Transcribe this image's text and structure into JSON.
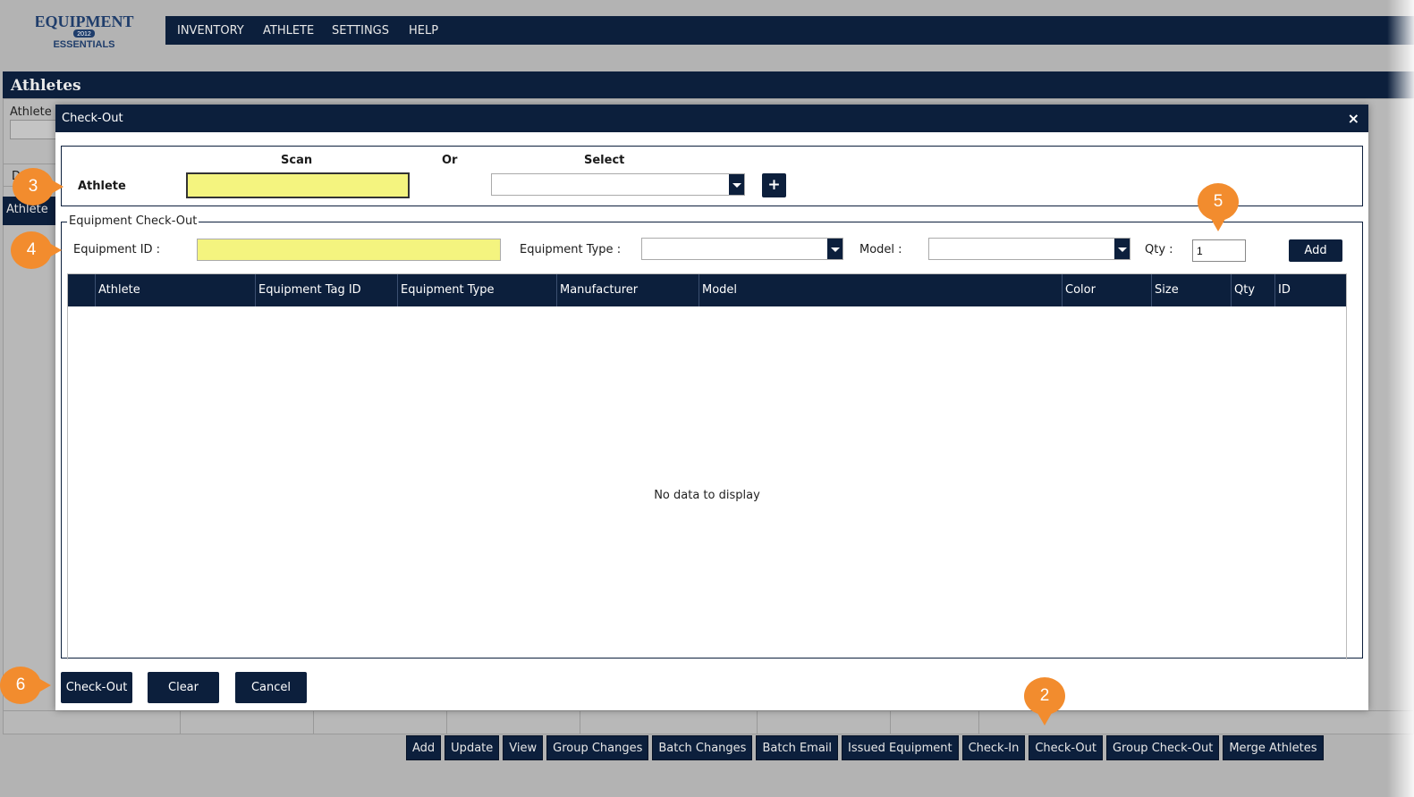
{
  "logo": {
    "line1": "EQUIPMENT",
    "year": "2012",
    "line2": "ESSENTIALS"
  },
  "topnav": {
    "items": [
      "INVENTORY",
      "ATHLETE",
      "SETTINGS",
      "HELP"
    ]
  },
  "page": {
    "title": "Athletes",
    "athlete_label": "Athlete",
    "side_tab_letter": "D",
    "side_tab_active": "Athlete"
  },
  "toolbar": {
    "buttons": [
      "Add",
      "Update",
      "View",
      "Group Changes",
      "Batch Changes",
      "Batch Email",
      "Issued Equipment",
      "Check-In",
      "Check-Out",
      "Group Check-Out",
      "Merge Athletes"
    ]
  },
  "modal": {
    "title": "Check-Out",
    "close_symbol": "×",
    "athlete_section": {
      "scan_header": "Scan",
      "or_header": "Or",
      "select_header": "Select",
      "athlete_label": "Athlete",
      "scan_value": "",
      "select_value": "",
      "plus_symbol": "+"
    },
    "equipment_section": {
      "legend": "Equipment Check-Out",
      "equipment_id_label": "Equipment ID :",
      "equipment_id_value": "",
      "equipment_type_label": "Equipment Type :",
      "equipment_type_value": "",
      "model_label": "Model :",
      "model_value": "",
      "qty_label": "Qty :",
      "qty_value": "1",
      "add_label": "Add"
    },
    "grid": {
      "columns": [
        "Athlete",
        "Equipment Tag ID",
        "Equipment Type",
        "Manufacturer",
        "Model",
        "Color",
        "Size",
        "Qty",
        "ID"
      ],
      "empty_message": "No data to display"
    },
    "footer": {
      "checkout_label": "Check-Out",
      "clear_label": "Clear",
      "cancel_label": "Cancel"
    }
  },
  "callouts": [
    "2",
    "3",
    "4",
    "5",
    "6"
  ],
  "colors": {
    "navy": "#0c1f3c",
    "highlight_yellow": "#f4f47f",
    "callout_orange": "#f28c2e"
  }
}
